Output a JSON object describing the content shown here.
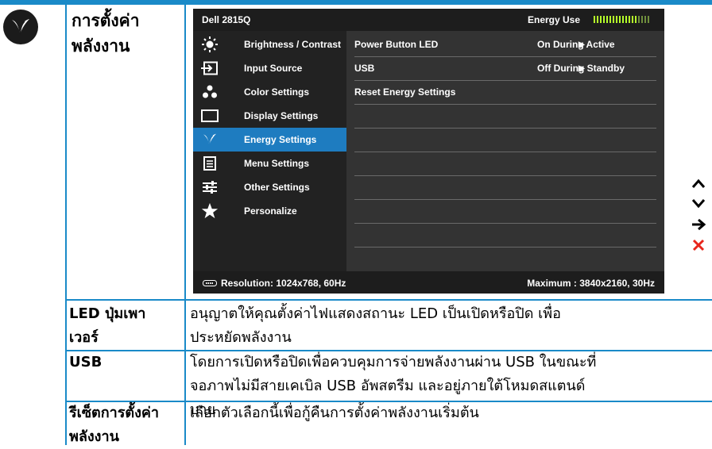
{
  "section": {
    "title_line1": "การตั้งค่า",
    "title_line2": "พลังงาน"
  },
  "osd": {
    "model": "Dell 2815Q",
    "energy_use_label": "Energy Use",
    "energy_meter_level": 0.8,
    "menu": [
      {
        "label": "Brightness / Contrast",
        "icon": "brightness-icon"
      },
      {
        "label": "Input Source",
        "icon": "input-source-icon"
      },
      {
        "label": "Color Settings",
        "icon": "color-settings-icon"
      },
      {
        "label": "Display Settings",
        "icon": "display-settings-icon"
      },
      {
        "label": "Energy Settings",
        "icon": "energy-leaf-icon",
        "active": true
      },
      {
        "label": "Menu Settings",
        "icon": "menu-settings-icon"
      },
      {
        "label": "Other Settings",
        "icon": "other-settings-icon"
      },
      {
        "label": "Personalize",
        "icon": "star-icon"
      }
    ],
    "rows": [
      {
        "label": "Power Button LED",
        "value": "On During Active"
      },
      {
        "label": "USB",
        "value": "Off During Standby"
      },
      {
        "label": "Reset Energy Settings",
        "value": ""
      }
    ],
    "resolution": "Resolution: 1024x768,  60Hz",
    "maximum": "Maximum : 3840x2160,  30Hz"
  },
  "nav": [
    "up-icon",
    "down-icon",
    "enter-icon",
    "exit-icon"
  ],
  "table": [
    {
      "label_lines": [
        "LED ปุ่มเพา",
        "เวอร์"
      ],
      "desc_lines": [
        "อนุญาตให้คุณตั้งค่าไฟแสดงสถานะ LED เป็นเปิดหรือปิด เพื่อ",
        "ประหยัดพลังงาน"
      ]
    },
    {
      "label_lines": [
        "USB"
      ],
      "desc_lines": [
        "โดยการเปิดหรือปิดเพื่อควบคุมการจ่ายพลังงานผ่าน USB ในขณะที่",
        "จอภาพไม่มีสายเคเบิล USB อัพสตรีม และอยู่ภายใต้โหมดสแตนด์",
        "บาย"
      ]
    },
    {
      "label_lines": [
        "รีเซ็ตการตั้งค่า",
        "พลังงาน"
      ],
      "desc_lines": [
        "เลือกตัวเลือกนี้เพื่อกู้คืนการตั้งค่าพลังงานเริ่มต้น"
      ]
    }
  ]
}
